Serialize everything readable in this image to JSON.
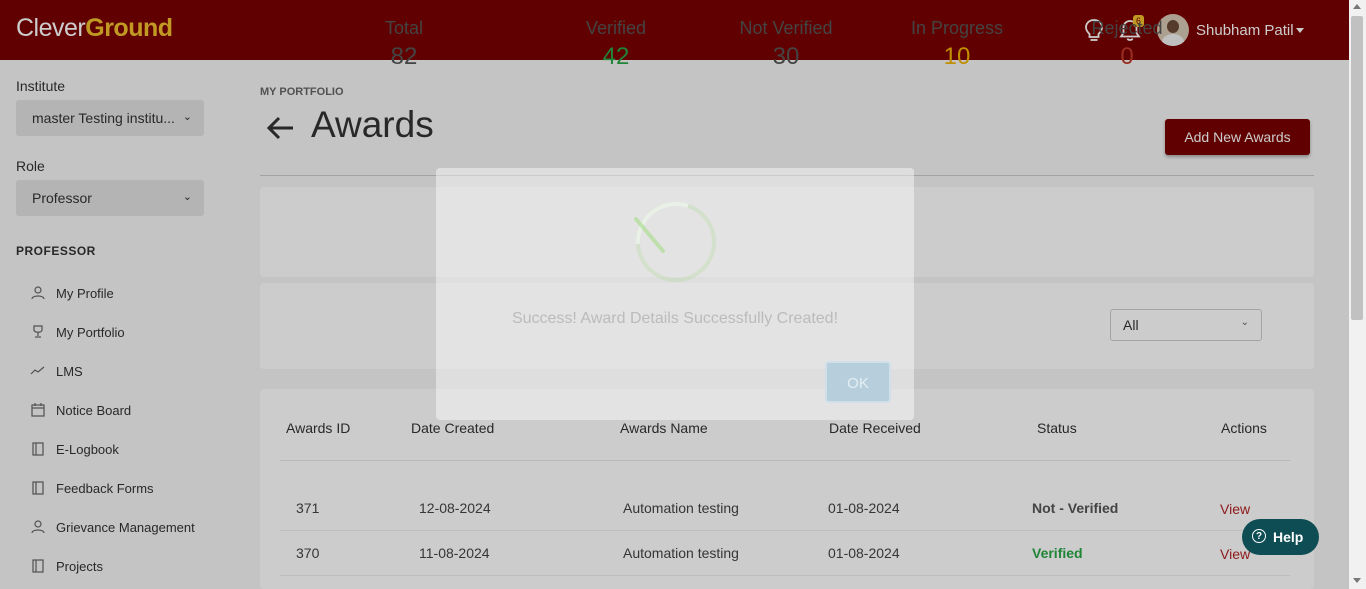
{
  "header": {
    "logo_part1": "Clever",
    "logo_part2": "Ground",
    "notification_count": "6",
    "user_name": "Shubham Patil"
  },
  "sidebar": {
    "institute_label": "Institute",
    "institute_value": "master Testing institu...",
    "role_label": "Role",
    "role_value": "Professor",
    "section_title": "PROFESSOR",
    "items": [
      {
        "label": "My Profile",
        "icon": "user-icon"
      },
      {
        "label": "My Portfolio",
        "icon": "trophy-icon"
      },
      {
        "label": "LMS",
        "icon": "chart-line-icon"
      },
      {
        "label": "Notice Board",
        "icon": "calendar-icon"
      },
      {
        "label": "E-Logbook",
        "icon": "book-icon"
      },
      {
        "label": "Feedback Forms",
        "icon": "book-icon"
      },
      {
        "label": "Grievance Management",
        "icon": "user-icon"
      },
      {
        "label": "Projects",
        "icon": "book-icon"
      }
    ]
  },
  "main": {
    "breadcrumb": "MY PORTFOLIO",
    "title": "Awards",
    "add_button": "Add New Awards",
    "stats": [
      {
        "label": "Total",
        "value": "82",
        "color": "#555555"
      },
      {
        "label": "Verified",
        "value": "42",
        "color": "#28a745"
      },
      {
        "label": "Not Verified",
        "value": "30",
        "color": "#555555"
      },
      {
        "label": "In Progress",
        "value": "10",
        "color": "#f0b400"
      },
      {
        "label": "Rejected",
        "value": "0",
        "color": "#c0392b"
      }
    ],
    "filter_value": "All",
    "table": {
      "headers": [
        "Awards ID",
        "Date Created",
        "Awards Name",
        "Date Received",
        "Status",
        "Actions"
      ],
      "rows": [
        {
          "id": "371",
          "created": "12-08-2024",
          "name": "Automation testing",
          "received": "01-08-2024",
          "status": "Not - Verified",
          "action": "View"
        },
        {
          "id": "370",
          "created": "11-08-2024",
          "name": "Automation testing",
          "received": "01-08-2024",
          "status": "Verified",
          "action": "View"
        }
      ]
    }
  },
  "modal": {
    "message": "Success! Award Details Successfully Created!",
    "ok_label": "OK"
  },
  "help": {
    "label": "Help"
  },
  "colors": {
    "brand": "#7a0000",
    "accent": "#f2c12e",
    "help_bg": "#0e4d53"
  }
}
